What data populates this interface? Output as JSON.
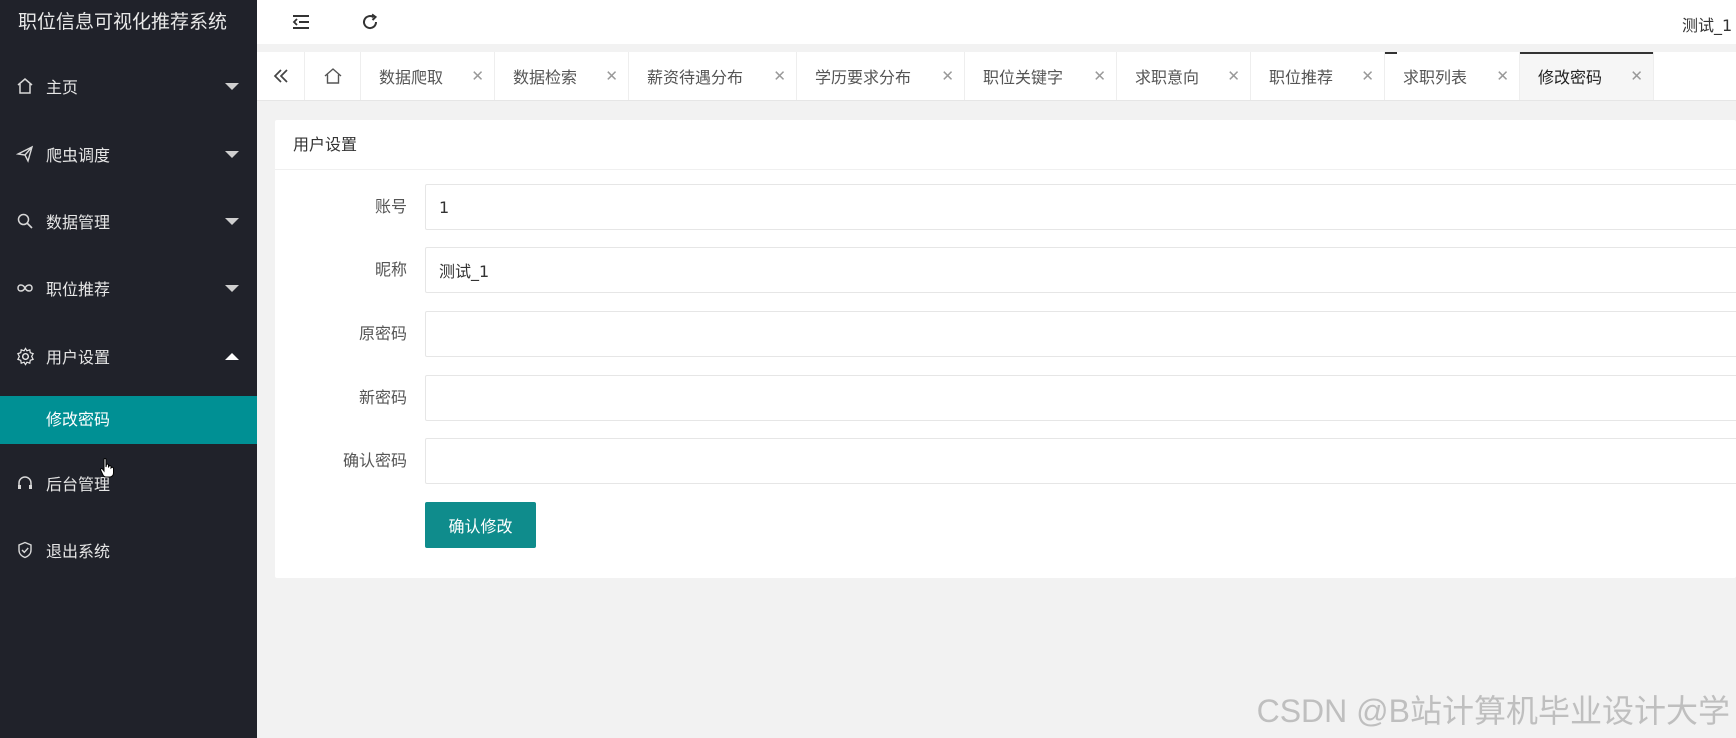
{
  "app": {
    "title": "职位信息可视化推荐系统",
    "user_name": "测试_1"
  },
  "sidebar": {
    "items": [
      {
        "label": "主页",
        "icon": "home-icon",
        "expanded": false
      },
      {
        "label": "爬虫调度",
        "icon": "paper-plane-icon",
        "expanded": false
      },
      {
        "label": "数据管理",
        "icon": "search-icon",
        "expanded": false
      },
      {
        "label": "职位推荐",
        "icon": "infinity-icon",
        "expanded": false
      },
      {
        "label": "用户设置",
        "icon": "gear-icon",
        "expanded": true
      },
      {
        "label": "后台管理",
        "icon": "headset-icon"
      },
      {
        "label": "退出系统",
        "icon": "shield-check-icon"
      }
    ],
    "sub_items": [
      {
        "label": "修改密码",
        "active": true
      }
    ]
  },
  "tabs": [
    {
      "label": "数据爬取"
    },
    {
      "label": "数据检索"
    },
    {
      "label": "薪资待遇分布"
    },
    {
      "label": "学历要求分布"
    },
    {
      "label": "职位关键字"
    },
    {
      "label": "求职意向"
    },
    {
      "label": "职位推荐"
    },
    {
      "label": "求职列表"
    },
    {
      "label": "修改密码",
      "active": true
    }
  ],
  "card": {
    "title": "用户设置"
  },
  "form": {
    "account_label": "账号",
    "account_value": "1",
    "nickname_label": "昵称",
    "nickname_value": "测试_1",
    "old_password_label": "原密码",
    "new_password_label": "新密码",
    "confirm_password_label": "确认密码",
    "submit_label": "确认修改"
  },
  "watermark": "CSDN @B站计算机毕业设计大学",
  "colors": {
    "sidebar_bg": "#20222a",
    "accent": "#009094",
    "button": "#0f8c8c"
  }
}
